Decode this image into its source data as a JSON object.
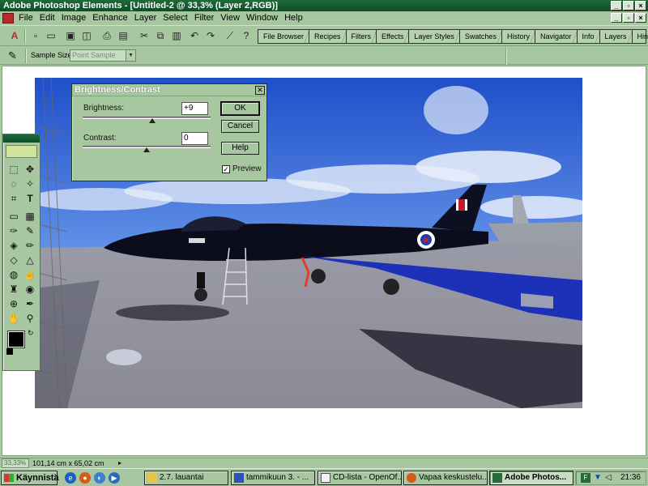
{
  "window": {
    "title": "Adobe Photoshop Elements - [Untitled-2 @ 33,3% (Layer 2,RGB)]",
    "controls": [
      "_",
      "▫",
      "×"
    ]
  },
  "menu": {
    "items": [
      "File",
      "Edit",
      "Image",
      "Enhance",
      "Layer",
      "Select",
      "Filter",
      "View",
      "Window",
      "Help"
    ]
  },
  "palette_well": {
    "tabs": [
      "File Browser",
      "Recipes",
      "Filters",
      "Effects",
      "Layer Styles",
      "Swatches",
      "History",
      "Navigator",
      "Info",
      "Layers",
      "Hints"
    ]
  },
  "options": {
    "sample_size_label": "Sample Size:",
    "sample_size_value": "Point Sample"
  },
  "dialog": {
    "title": "Brightness/Contrast",
    "brightness_label": "Brightness:",
    "brightness_value": "+9",
    "brightness_level": 9,
    "contrast_label": "Contrast:",
    "contrast_value": "0",
    "contrast_level": 0,
    "ok_label": "OK",
    "cancel_label": "Cancel",
    "help_label": "Help",
    "preview_label": "Preview",
    "preview_checked": true
  },
  "status": {
    "zoom": "33,33%",
    "document_size": "101,14 cm x 65,02 cm"
  },
  "taskbar": {
    "start_label": "Käynnistä",
    "tasks": [
      {
        "label": "2.7. lauantai",
        "active": false
      },
      {
        "label": "tammikuun 3. - ...",
        "active": false
      },
      {
        "label": "CD-lista - OpenOf...",
        "active": false
      },
      {
        "label": "Vapaa keskustelu...",
        "active": false
      },
      {
        "label": "Adobe Photos...",
        "active": true
      }
    ],
    "clock": "21:36"
  },
  "colors": {
    "ui_green": "#a7c7a0",
    "title_green": "#0f4c26"
  }
}
